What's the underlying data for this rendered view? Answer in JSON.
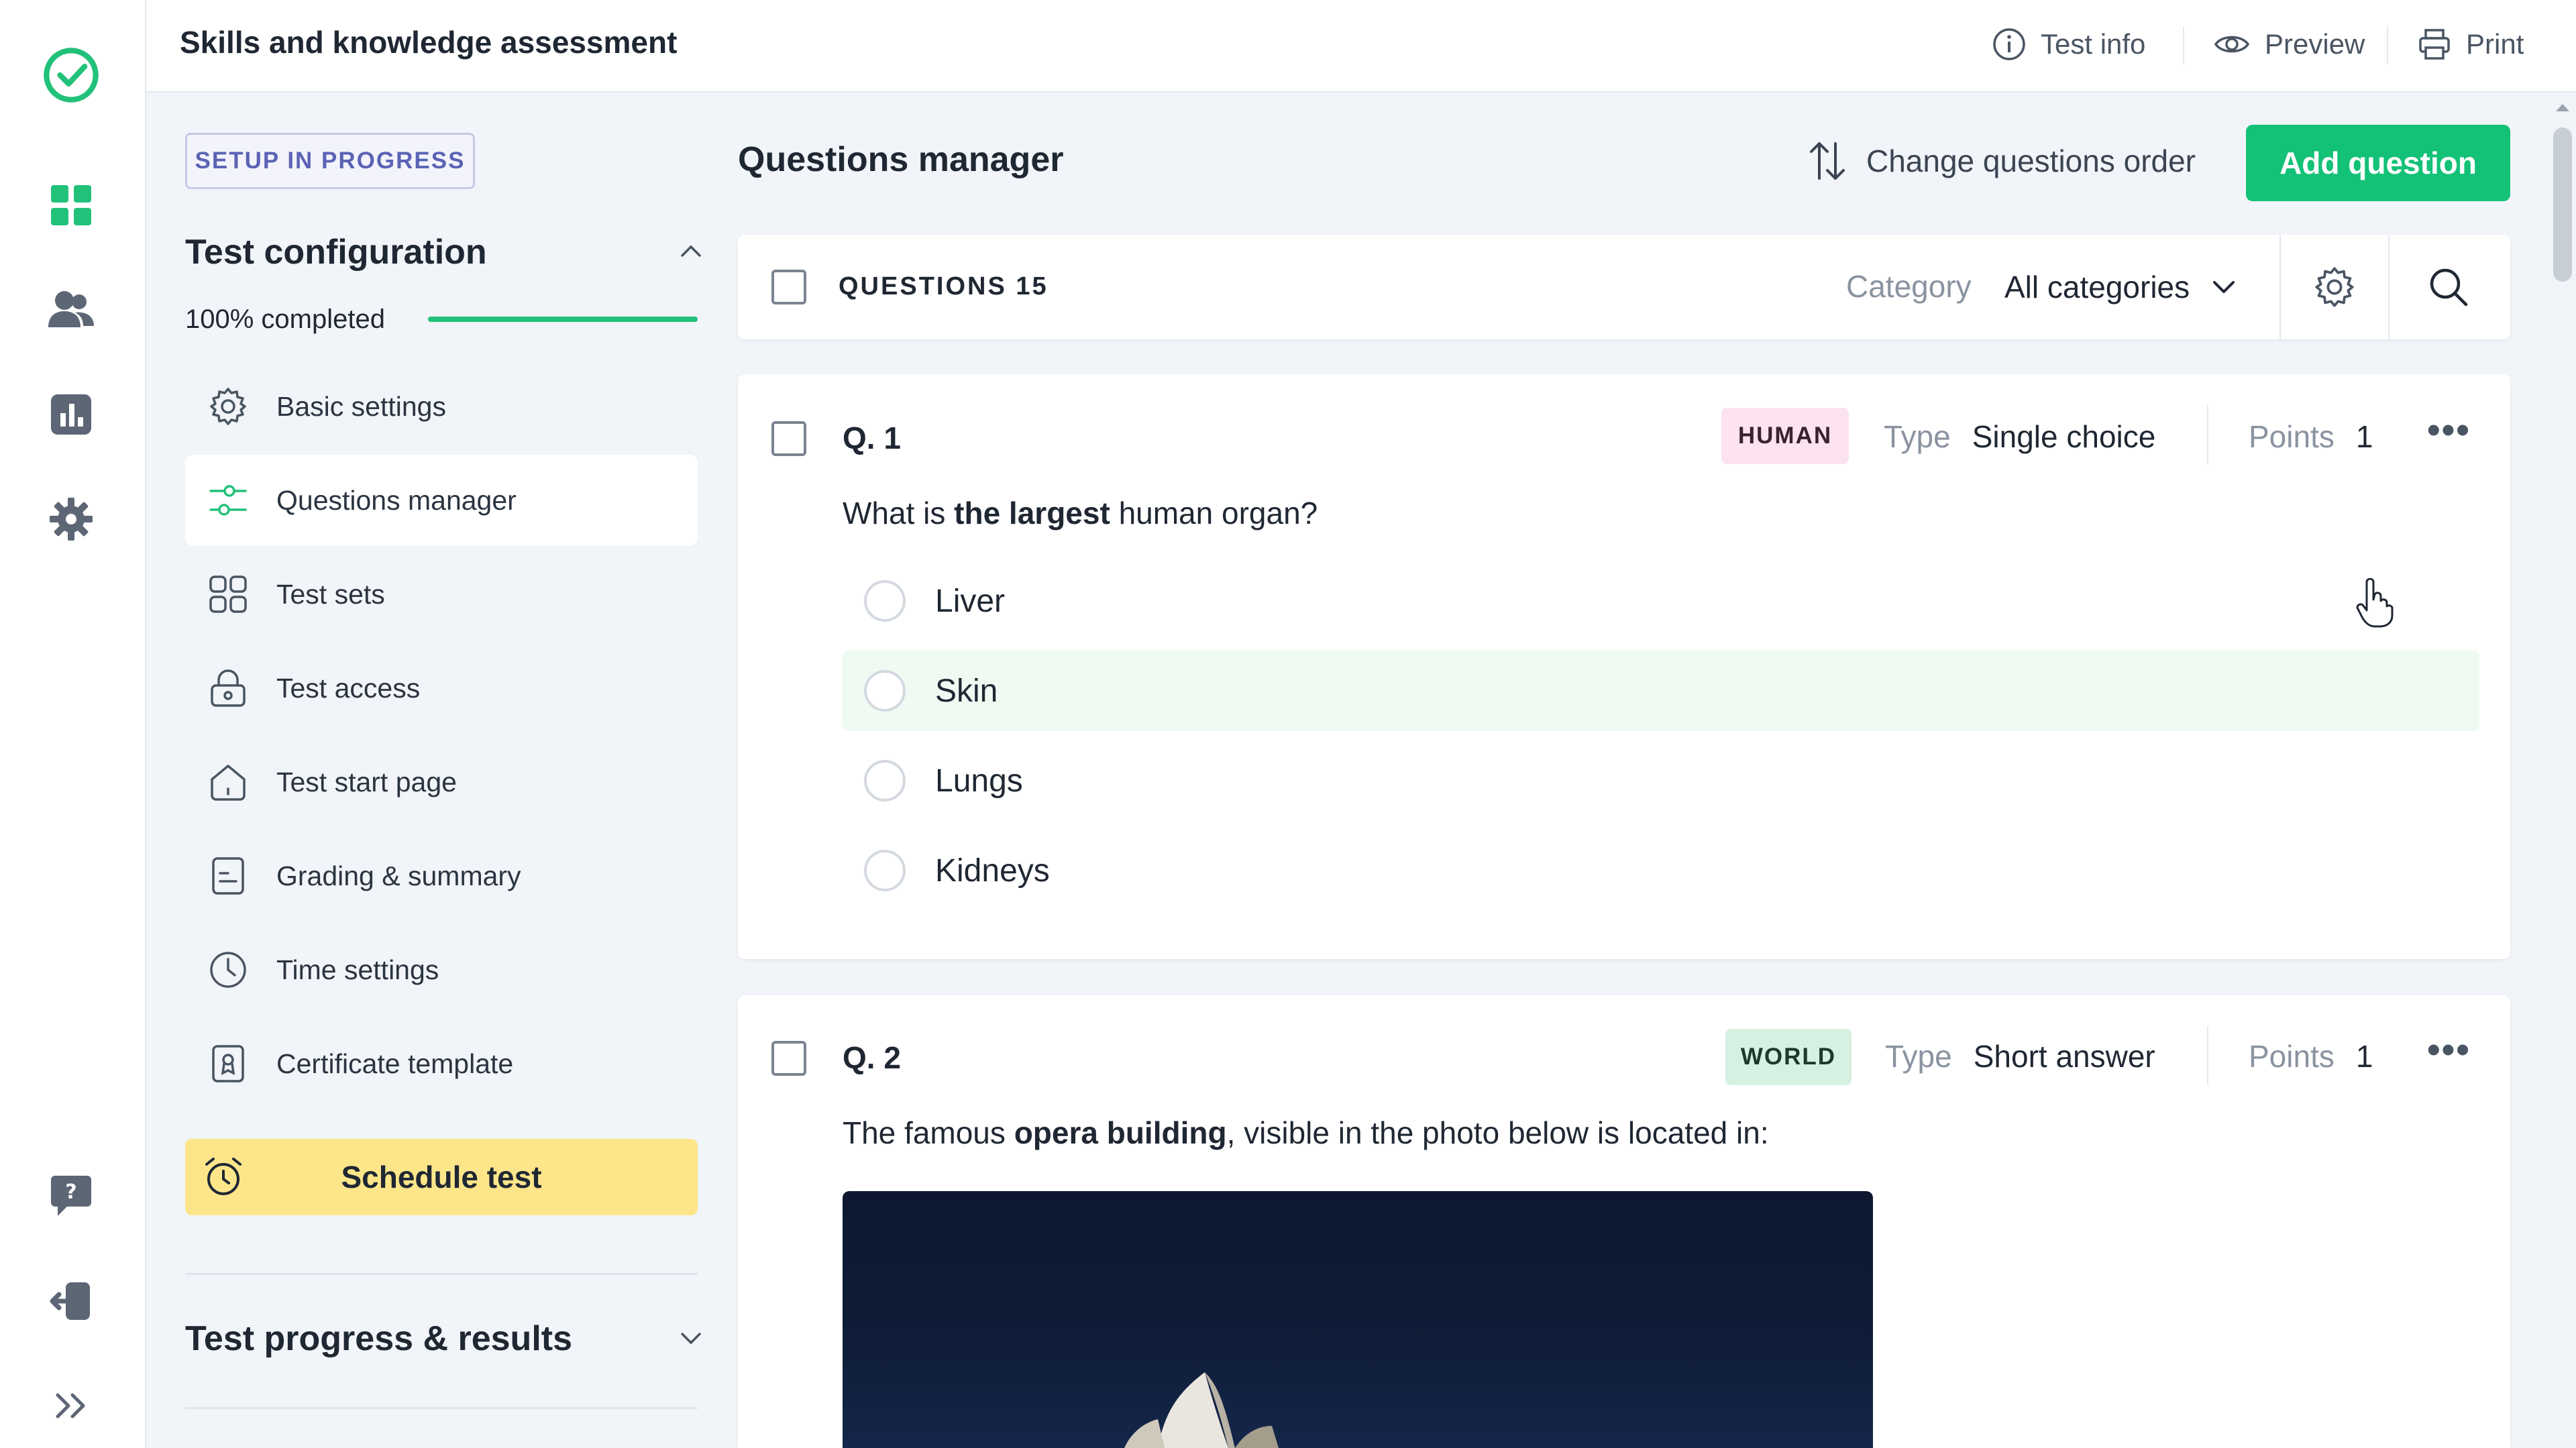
{
  "app": {
    "title": "Skills and knowledge assessment",
    "accent": "#13c177"
  },
  "top_actions": {
    "test_info": "Test info",
    "preview": "Preview",
    "print": "Print"
  },
  "rail": {
    "icons": [
      "logo-check-icon",
      "dashboard-icon",
      "users-icon",
      "reports-icon",
      "settings-gear-icon",
      "help-icon",
      "logout-icon",
      "expand-icon"
    ]
  },
  "sidebar": {
    "status_badge": "SETUP IN PROGRESS",
    "config_title": "Test configuration",
    "progress_label": "100% completed",
    "progress_value": 1.0,
    "items": [
      {
        "label": "Basic settings",
        "icon": "gear-icon",
        "active": false
      },
      {
        "label": "Questions manager",
        "icon": "sliders-icon",
        "active": true
      },
      {
        "label": "Test sets",
        "icon": "grid-icon",
        "active": false
      },
      {
        "label": "Test access",
        "icon": "lock-icon",
        "active": false
      },
      {
        "label": "Test start page",
        "icon": "home-icon",
        "active": false
      },
      {
        "label": "Grading & summary",
        "icon": "document-icon",
        "active": false
      },
      {
        "label": "Time settings",
        "icon": "clock-icon",
        "active": false
      },
      {
        "label": "Certificate template",
        "icon": "certificate-icon",
        "active": false
      }
    ],
    "schedule_label": "Schedule test",
    "results_title": "Test progress & results"
  },
  "main": {
    "title": "Questions manager",
    "change_order_label": "Change questions order",
    "add_question_label": "Add question",
    "filter": {
      "questions_label": "QUESTIONS 15",
      "category_label": "Category",
      "category_value": "All categories"
    },
    "questions": [
      {
        "number": "Q. 1",
        "tag": "HUMAN",
        "type_label": "Type",
        "type_value": "Single choice",
        "points_label": "Points",
        "points_value": "1",
        "text_before": "What is ",
        "text_bold": "the largest",
        "text_after": " human organ?",
        "answers": [
          "Liver",
          "Skin",
          "Lungs",
          "Kidneys"
        ]
      },
      {
        "number": "Q. 2",
        "tag": "WORLD",
        "type_label": "Type",
        "type_value": "Short answer",
        "points_label": "Points",
        "points_value": "1",
        "text_before": "The famous ",
        "text_bold": "opera building",
        "text_after": ", visible in the photo below is located in:"
      }
    ]
  }
}
